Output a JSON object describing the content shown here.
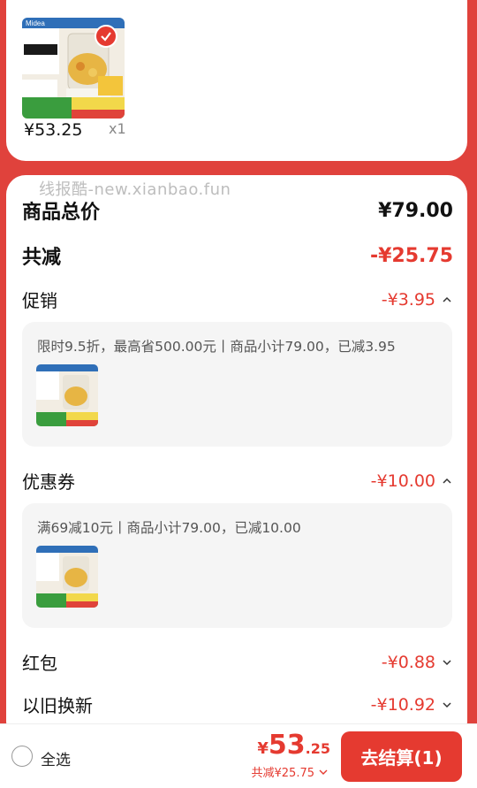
{
  "product": {
    "price": "¥53.25",
    "quantity": "x1",
    "brand_logo": "Midea"
  },
  "watermark": "线报酷-new.xianbao.fun",
  "summary": {
    "total_label": "商品总价",
    "total_value": "¥79.00",
    "reduced_label": "共减",
    "reduced_value": "-¥25.75",
    "promotion": {
      "label": "促销",
      "value": "-¥3.95",
      "detail": "限时9.5折，最高省500.00元丨商品小计79.00，已减3.95"
    },
    "coupon": {
      "label": "优惠券",
      "value": "-¥10.00",
      "detail": "满69减10元丨商品小计79.00，已减10.00"
    },
    "red_packet": {
      "label": "红包",
      "value": "-¥0.88"
    },
    "trade_in": {
      "label": "以旧换新",
      "value": "-¥10.92"
    }
  },
  "bottom": {
    "select_all": "全选",
    "currency": "¥",
    "price_int": "53",
    "price_dec": ".25",
    "saved_text": "共减¥25.75",
    "checkout_label": "去结算(1)"
  },
  "colors": {
    "accent": "#e53a30",
    "background": "#e0423c"
  },
  "icons": [
    "check-badge-icon",
    "chevron-up-icon",
    "chevron-down-icon",
    "radio-icon"
  ]
}
